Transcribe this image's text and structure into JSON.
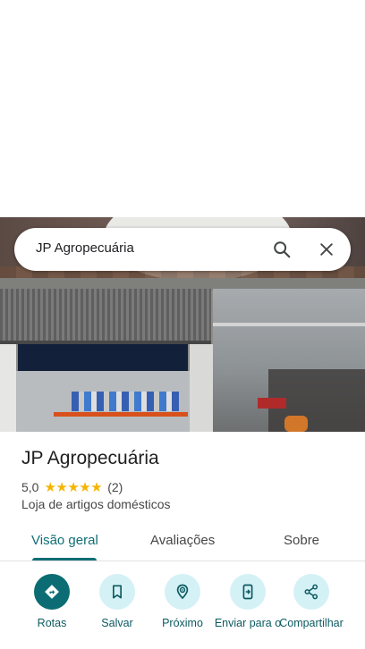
{
  "search": {
    "query": "JP Agropecuária"
  },
  "place": {
    "name": "JP Agropecuária",
    "rating": "5,0",
    "stars": "★★★★★",
    "review_count": "(2)",
    "category": "Loja de artigos domésticos"
  },
  "tabs": [
    {
      "label": "Visão geral",
      "active": true
    },
    {
      "label": "Avaliações",
      "active": false
    },
    {
      "label": "Sobre",
      "active": false
    }
  ],
  "actions": [
    {
      "label": "Rotas",
      "icon": "directions-icon"
    },
    {
      "label": "Salvar",
      "icon": "bookmark-icon"
    },
    {
      "label": "Próximo",
      "icon": "nearby-icon"
    },
    {
      "label": "Enviar para o",
      "icon": "send-to-phone-icon"
    },
    {
      "label": "Compartilhar",
      "icon": "share-icon"
    }
  ],
  "colors": {
    "accent": "#0f6e75",
    "action_bg": "#d4f1f6",
    "star": "#f6b400"
  }
}
